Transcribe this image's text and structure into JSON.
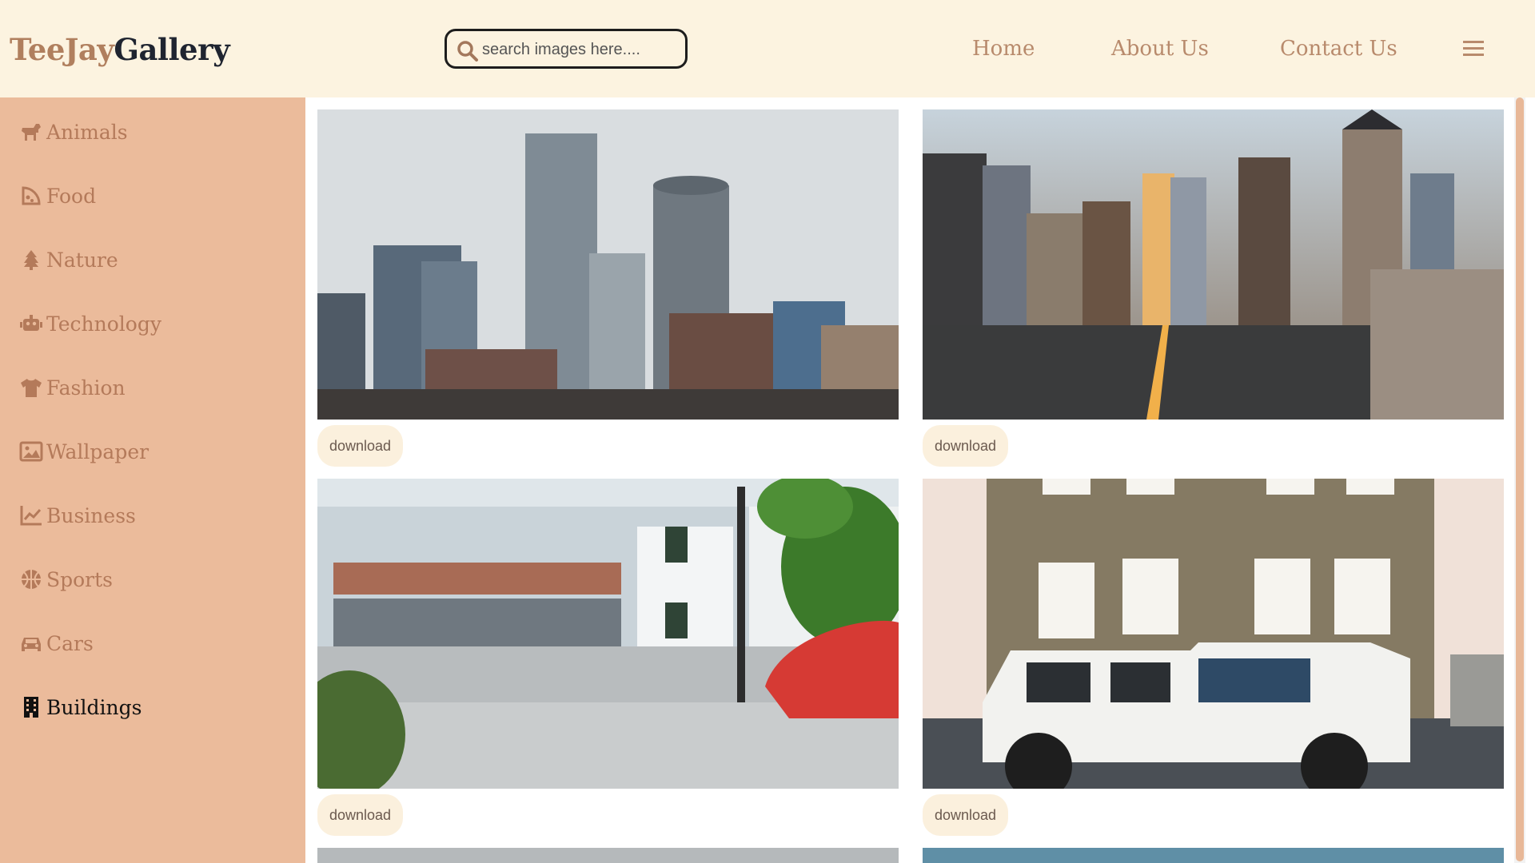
{
  "header": {
    "logo_part1": "TeeJay",
    "logo_part2": "Gallery",
    "search_placeholder": "search images here....",
    "nav": [
      "Home",
      "About Us",
      "Contact Us"
    ]
  },
  "sidebar": {
    "items": [
      {
        "label": "Animals",
        "icon": "dog-icon"
      },
      {
        "label": "Food",
        "icon": "pizza-icon"
      },
      {
        "label": "Nature",
        "icon": "tree-icon"
      },
      {
        "label": "Technology",
        "icon": "robot-icon"
      },
      {
        "label": "Fashion",
        "icon": "shirt-icon"
      },
      {
        "label": "Wallpaper",
        "icon": "image-icon"
      },
      {
        "label": "Business",
        "icon": "chart-line-icon"
      },
      {
        "label": "Sports",
        "icon": "basketball-icon"
      },
      {
        "label": "Cars",
        "icon": "car-icon"
      },
      {
        "label": "Buildings",
        "icon": "building-icon",
        "active": true
      }
    ]
  },
  "gallery": {
    "download_label": "download"
  },
  "colors": {
    "header_bg": "#fcf3e0",
    "sidebar_bg": "#ebbb9b",
    "accent": "#b88a6c",
    "active": "#111111"
  }
}
